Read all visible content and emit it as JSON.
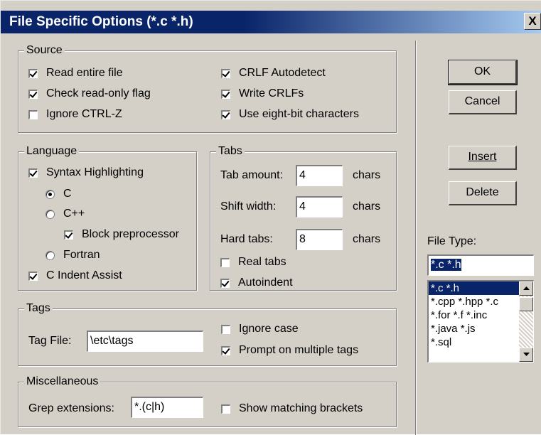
{
  "window": {
    "title": "File Specific Options (*.c *.h)",
    "close_glyph": "X"
  },
  "source": {
    "legend": "Source",
    "read_entire_file": "Read entire file",
    "check_readonly": "Check read-only flag",
    "ignore_ctrlz": "Ignore CTRL-Z",
    "crlf_autodetect": "CRLF Autodetect",
    "write_crlfs": "Write CRLFs",
    "eight_bit": "Use eight-bit characters"
  },
  "language": {
    "legend": "Language",
    "syntax_highlighting": "Syntax Highlighting",
    "c": "C",
    "cpp": "C++",
    "block_preprocessor": "Block preprocessor",
    "fortran": "Fortran",
    "c_indent_assist": "C Indent Assist"
  },
  "tabs": {
    "legend": "Tabs",
    "tab_amount_label": "Tab amount:",
    "tab_amount_value": "4",
    "shift_width_label": "Shift width:",
    "shift_width_value": "4",
    "hard_tabs_label": "Hard tabs:",
    "hard_tabs_value": "8",
    "units": "chars",
    "real_tabs": "Real tabs",
    "autoindent": "Autoindent"
  },
  "tags": {
    "legend": "Tags",
    "tag_file_label": "Tag File:",
    "tag_file_value": "\\etc\\tags",
    "ignore_case": "Ignore case",
    "prompt_multiple": "Prompt on multiple tags"
  },
  "misc": {
    "legend": "Miscellaneous",
    "grep_label": "Grep extensions:",
    "grep_value": "*.(c|h)",
    "show_brackets": "Show matching brackets"
  },
  "buttons": {
    "ok": "OK",
    "cancel": "Cancel",
    "insert": "Insert",
    "delete": "Delete"
  },
  "file_type": {
    "label": "File Type:",
    "value": "*.c *.h",
    "items": [
      "*.c *.h",
      "*.cpp *.hpp *.c",
      "*.for *.f *.inc",
      "*.java *.js",
      "*.sql"
    ]
  },
  "colors": {
    "title_bar": "#0a246a",
    "face": "#d4d0c8",
    "selection": "#0a246a"
  }
}
